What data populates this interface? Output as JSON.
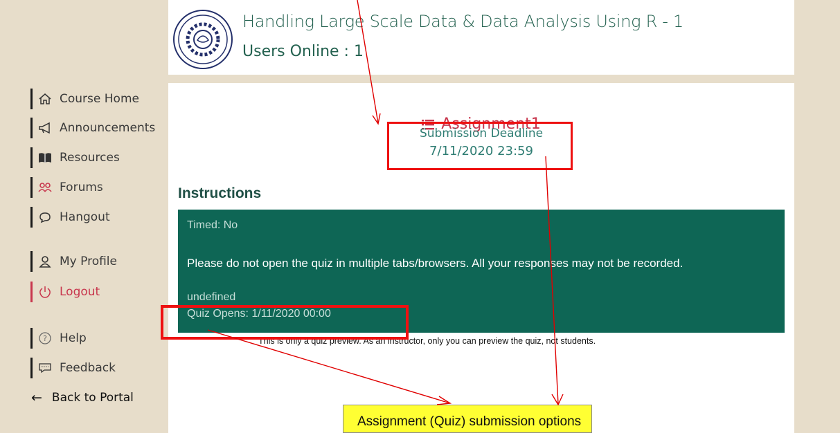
{
  "header": {
    "course_title": "Handling Large Scale Data & Data Analysis Using R - 1",
    "users_online": "Users Online : 1"
  },
  "sidebar": {
    "items": [
      {
        "label": "Course Home",
        "icon": "home-icon"
      },
      {
        "label": "Announcements",
        "icon": "megaphone-icon"
      },
      {
        "label": "Resources",
        "icon": "book-icon"
      },
      {
        "label": "Forums",
        "icon": "users-icon"
      },
      {
        "label": "Hangout",
        "icon": "chat-bubble-icon"
      },
      {
        "label": "My Profile",
        "icon": "user-icon"
      },
      {
        "label": "Logout",
        "icon": "power-icon"
      },
      {
        "label": "Help",
        "icon": "help-icon"
      },
      {
        "label": "Feedback",
        "icon": "feedback-icon"
      }
    ],
    "back_to_portal": "Back to Portal"
  },
  "assignment": {
    "title": "Assignment1",
    "deadline_label": "Submission Deadline",
    "deadline_date": "7/11/2020 23:59"
  },
  "instructions": {
    "heading": "Instructions",
    "timed": "Timed: No",
    "warning": "Please do not open the quiz in multiple tabs/browsers. All your responses may not be recorded.",
    "undefined": "undefined",
    "quiz_opens": "Quiz Opens: 1/11/2020 00:00",
    "preview_note": "This is only a quiz preview. As an instructor, only you can preview the quiz, not students."
  },
  "annotation": {
    "callout": "Assignment (Quiz) submission options",
    "highlight_color": "#ee1111",
    "callout_color": "#ffff33"
  },
  "colors": {
    "accent_red": "#c8364d",
    "panel_green": "#0e6655",
    "sidebar_bg": "#e7ddca"
  }
}
